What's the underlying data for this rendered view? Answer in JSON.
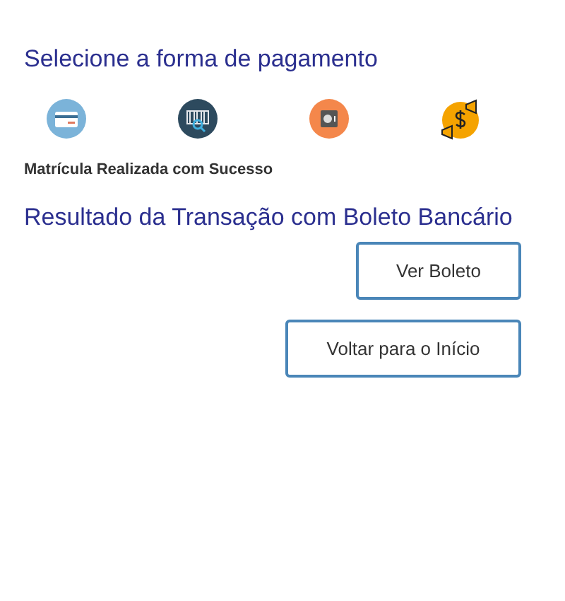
{
  "heading": "Selecione a forma de pagamento",
  "payment_methods": [
    {
      "kind": "card"
    },
    {
      "kind": "barcode"
    },
    {
      "kind": "safe"
    },
    {
      "kind": "money"
    }
  ],
  "status_message": "Matrícula Realizada com Sucesso",
  "result_title": "Resultado da Transação com Boleto Bancário",
  "buttons": [
    "Ver Boleto",
    "Voltar para o Início"
  ]
}
